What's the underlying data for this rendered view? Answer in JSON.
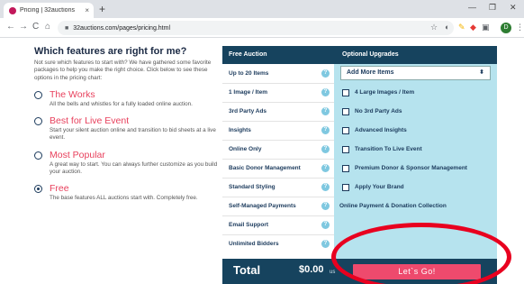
{
  "browser": {
    "tab_title": "Pricing | 32auctions",
    "tab_close": "×",
    "new_tab": "+",
    "url": "32auctions.com/pages/pricing.html",
    "controls": {
      "minimize": "—",
      "maximize": "❐",
      "close": "✕"
    },
    "nav": {
      "back": "←",
      "forward": "→",
      "reload": "C",
      "home": "⌂"
    },
    "avatar_initial": "D"
  },
  "page": {
    "heading": "Which features are right for me?",
    "intro": "Not sure which features to start with? We have gathered some favorite packages to help you make the right choice. Click below to see these options in the pricing chart:",
    "options": [
      {
        "title": "The Works",
        "desc": "All the bells and whistles for a fully loaded online auction.",
        "selected": false
      },
      {
        "title": "Best for Live Event",
        "desc": "Start your silent auction online and transition to bid sheets at a live event.",
        "selected": false
      },
      {
        "title": "Most Popular",
        "desc": "A great way to start. You can always further customize as you build your auction.",
        "selected": false
      },
      {
        "title": "Free",
        "desc": "The base features ALL auctions start with. Completely free.",
        "selected": true
      }
    ]
  },
  "pricing": {
    "free_header": "Free Auction",
    "optional_header": "Optional Upgrades",
    "help_glyph": "?",
    "rows": [
      {
        "feature": "Up to 20 Items",
        "upgrade": "Add More Items",
        "type": "select"
      },
      {
        "feature": "1 Image / Item",
        "upgrade": "4 Large Images / Item",
        "type": "checkbox"
      },
      {
        "feature": "3rd Party Ads",
        "upgrade": "No 3rd Party Ads",
        "type": "checkbox"
      },
      {
        "feature": "Insights",
        "upgrade": "Advanced Insights",
        "type": "checkbox"
      },
      {
        "feature": "Online Only",
        "upgrade": "Transition To Live Event",
        "type": "checkbox"
      },
      {
        "feature": "Basic Donor Management",
        "upgrade": "Premium Donor & Sponsor Management",
        "type": "checkbox"
      },
      {
        "feature": "Standard Styling",
        "upgrade": "Apply Your Brand",
        "type": "checkbox"
      },
      {
        "feature": "Self-Managed Payments",
        "upgrade": "Online Payment & Donation Collection",
        "type": "text"
      },
      {
        "feature": "Email Support",
        "upgrade": "",
        "type": "none"
      },
      {
        "feature": "Unlimited Bidders",
        "upgrade": "",
        "type": "none"
      }
    ],
    "select_arrow": "⬍",
    "total_label": "Total",
    "total_amount": "$0.00",
    "total_currency": "us",
    "cta_label": "Let`s Go!"
  },
  "colors": {
    "accent": "#ee4a6d",
    "navy": "#16435e",
    "upgrade_bg": "#b6e3ee",
    "annotation": "#e8001f"
  }
}
